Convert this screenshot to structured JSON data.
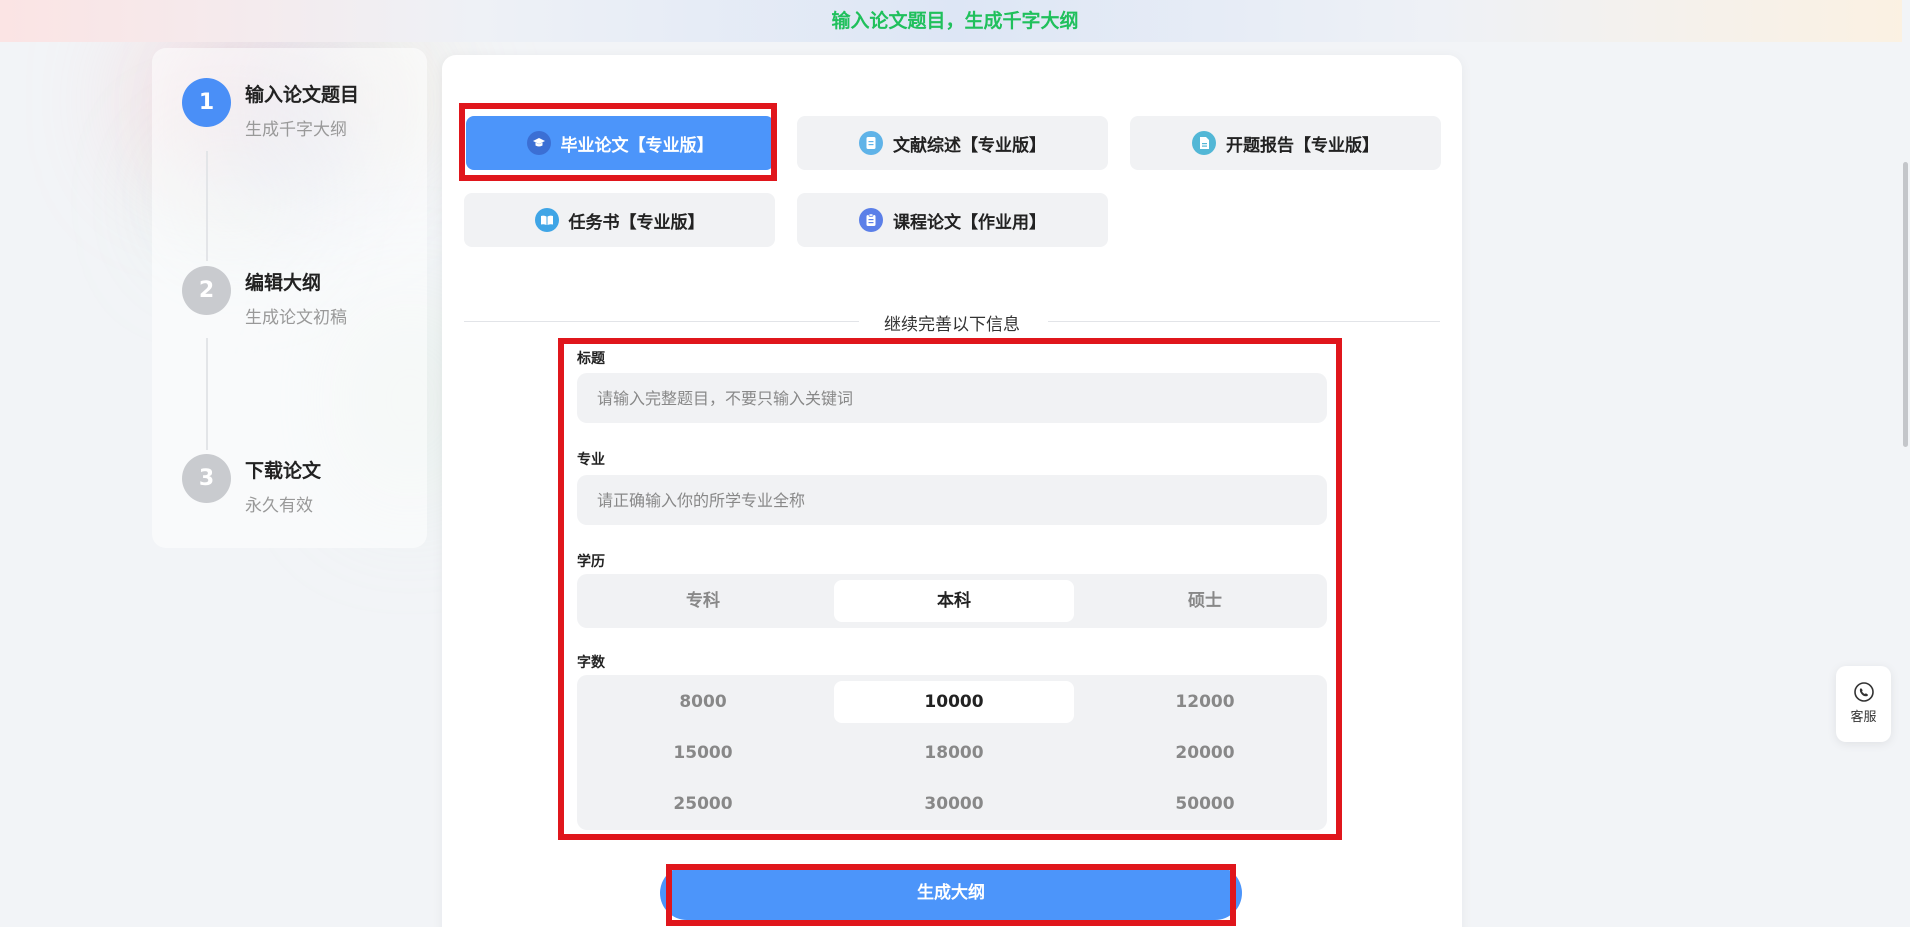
{
  "banner": {
    "text": "输入论文题目，生成千字大纲"
  },
  "steps": [
    {
      "number": "1",
      "title": "输入论文题目",
      "subtitle": "生成千字大纲",
      "active": true
    },
    {
      "number": "2",
      "title": "编辑大纲",
      "subtitle": "生成论文初稿",
      "active": false
    },
    {
      "number": "3",
      "title": "下载论文",
      "subtitle": "永久有效",
      "active": false
    }
  ],
  "paper_types": [
    {
      "label": "毕业论文【专业版】",
      "icon": "graduation-cap-icon",
      "selected": true
    },
    {
      "label": "文献综述【专业版】",
      "icon": "document-icon",
      "selected": false
    },
    {
      "label": "开题报告【专业版】",
      "icon": "report-icon",
      "selected": false
    },
    {
      "label": "任务书【专业版】",
      "icon": "book-icon",
      "selected": false
    },
    {
      "label": "课程论文【作业用】",
      "icon": "clipboard-icon",
      "selected": false
    }
  ],
  "divider": {
    "text": "继续完善以下信息"
  },
  "form": {
    "title_label": "标题",
    "title_placeholder": "请输入完整题目，不要只输入关键词",
    "major_label": "专业",
    "major_placeholder": "请正确输入你的所学专业全称",
    "education_label": "学历",
    "education_options": [
      "专科",
      "本科",
      "硕士"
    ],
    "education_selected": "本科",
    "wordcount_label": "字数",
    "wordcount_options": [
      "8000",
      "10000",
      "12000",
      "15000",
      "18000",
      "20000",
      "25000",
      "30000",
      "50000"
    ],
    "wordcount_selected": "10000"
  },
  "generate_button": {
    "label": "生成大纲"
  },
  "service": {
    "label": "客服",
    "icon": "customer-service-icon"
  },
  "colors": {
    "accent": "#4c95fa",
    "banner_text": "#20c05c",
    "highlight_frame": "#e0161c"
  }
}
